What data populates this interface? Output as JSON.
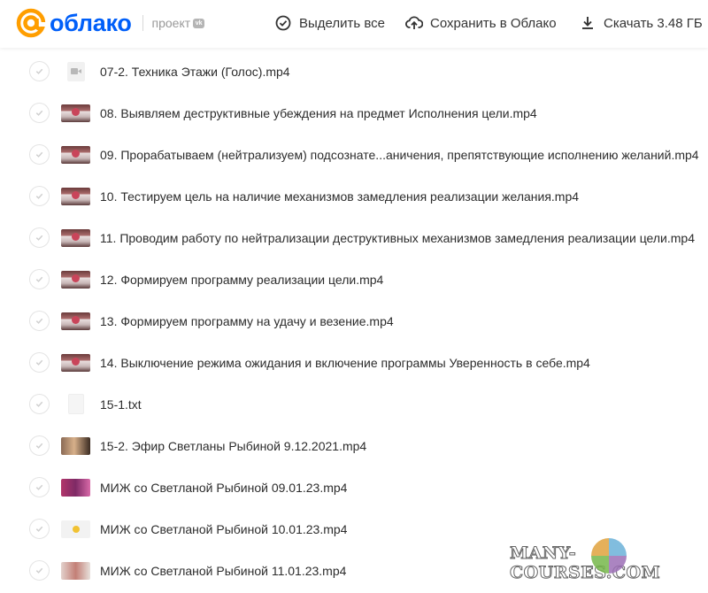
{
  "header": {
    "logo_text": "облако",
    "logo_project": "проект",
    "vk_badge": "vk",
    "select_all_label": "Выделить все",
    "save_label": "Сохранить в Облако",
    "download_label": "Скачать 3.48 ГБ",
    "brand_color": "#005ff9",
    "accent_color": "#ff9e00"
  },
  "files": [
    {
      "name": "07-2. Техника Этажи (Голос).mp4",
      "thumb": "video-icon"
    },
    {
      "name": "08. Выявляем деструктивные убеждения на предмет Исполнения цели.mp4",
      "thumb": "lecture"
    },
    {
      "name": "09. Прорабатываем (нейтрализуем) подсознате...аничения, препятствующие исполнению желаний.mp4",
      "thumb": "lecture"
    },
    {
      "name": "10. Тестируем цель на наличие механизмов замедления реализации желания.mp4",
      "thumb": "lecture"
    },
    {
      "name": "11. Проводим работу по нейтрализации деструктивных механизмов замедления реализации цели.mp4",
      "thumb": "lecture"
    },
    {
      "name": "12. Формируем программу реализации цели.mp4",
      "thumb": "lecture"
    },
    {
      "name": "13. Формируем программу на удачу и везение.mp4",
      "thumb": "lecture"
    },
    {
      "name": "14. Выключение режима ожидания и включение программы Уверенность в себе.mp4",
      "thumb": "lecture"
    },
    {
      "name": "15-1.txt",
      "thumb": "file-icon"
    },
    {
      "name": "15-2. Эфир Светланы Рыбиной 9.12.2021.mp4",
      "thumb": "portrait"
    },
    {
      "name": "МИЖ со Светланой Рыбиной 09.01.23.mp4",
      "thumb": "group"
    },
    {
      "name": "МИЖ со Светланой Рыбиной 10.01.23.mp4",
      "thumb": "dot"
    },
    {
      "name": "МИЖ со Светланой Рыбиной 11.01.23.mp4",
      "thumb": "woman"
    }
  ],
  "watermark": {
    "text": "MANY-COURSES.COM"
  }
}
